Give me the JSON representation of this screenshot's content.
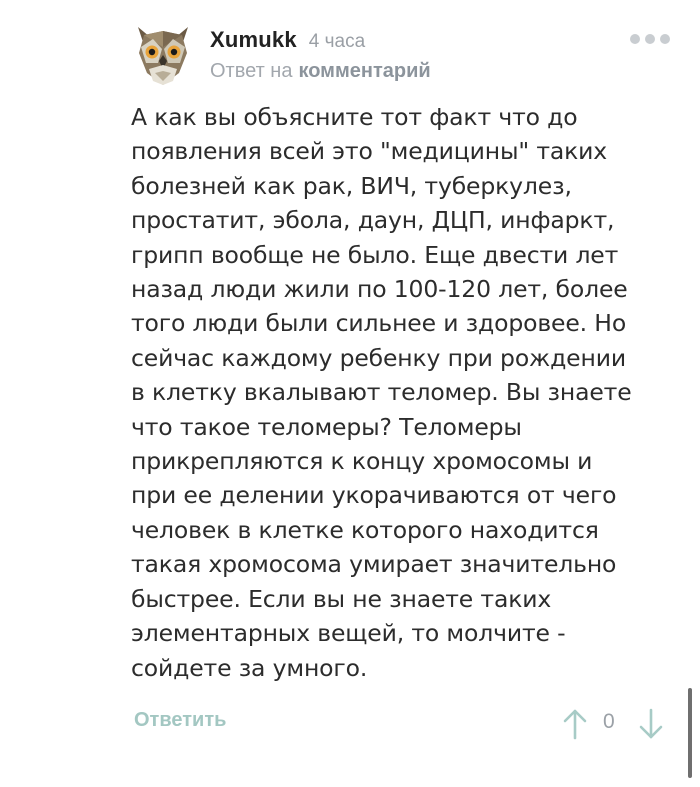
{
  "comment": {
    "author": "Xumukk",
    "time": "4 часа",
    "reply_prefix": "Ответ на",
    "reply_link": "комментарий",
    "text": "А как вы объясните тот факт что до\nпоявления всей это \"медицины\" таких\nболезней как рак, ВИЧ, туберкулез,\nпростатит, эбола, даун, ДЦП, инфаркт,\nгрипп вообще не было. Еще двести лет\nназад люди жили по 100-120 лет, более\nтого люди были сильнее и здоровее. Но\nсейчас каждому ребенку при рождении\nв клетку вкалывают теломер. Вы знаете\nчто такое теломеры? Теломеры\nприкрепляются к концу хромосомы и\nпри ее делении укорачиваются от чего\nчеловек в клетке которого находится\nтакая хромосома умирает значительно\nбыстрее. Если вы не знаете таких\nэлементарных вещей, то молчите -\nсойдете за умного.",
    "reply_button": "Ответить",
    "rating": "0"
  },
  "icons": {
    "avatar": "owl-avatar-icon",
    "more": "more-dots-icon",
    "vote_up": "arrow-up-icon",
    "vote_down": "arrow-down-icon"
  },
  "colors": {
    "accent": "#a3c7c2",
    "muted": "#9a9fa5",
    "dots": "#c9cdd1",
    "text": "#2c2c2c"
  }
}
